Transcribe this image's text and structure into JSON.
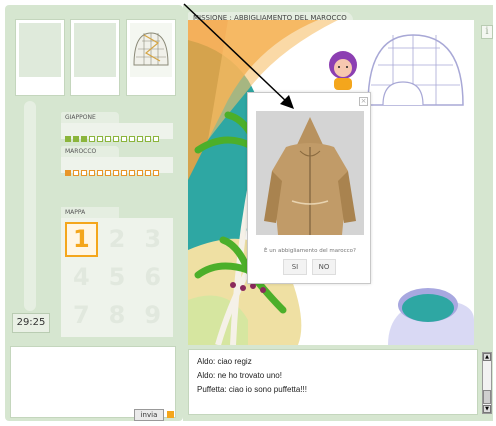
{
  "mission": {
    "title": "MISSIONE : ABBIGLIAMENTO DEL MAROCCO"
  },
  "info_icon": "i",
  "timer": "29:25",
  "countries": [
    {
      "name": "GIAPPONE",
      "progress": 3,
      "total": 12,
      "color": "#8bb53c"
    },
    {
      "name": "MAROCCO",
      "progress": 1,
      "total": 12,
      "color": "#e8962a"
    }
  ],
  "map": {
    "label": "MAPPA",
    "cells": [
      "1",
      "2",
      "3",
      "4",
      "5",
      "6",
      "7",
      "8",
      "9"
    ],
    "active": "1"
  },
  "compose": {
    "send_label": "invia"
  },
  "popup": {
    "question": "È un abbigliamento del marocco?",
    "yes_label": "SI",
    "no_label": "NO",
    "close_icon": "close-icon"
  },
  "chat": {
    "messages": [
      "Aldo: ciao regiz",
      "Aldo: ne ho trovato uno!",
      "Puffetta: ciao io sono puffetta!!!"
    ]
  },
  "colors": {
    "panel": "#d6e6d0",
    "accent_orange": "#f4a61c",
    "teal": "#2ea7a3",
    "palm_green": "#4caf2a"
  }
}
